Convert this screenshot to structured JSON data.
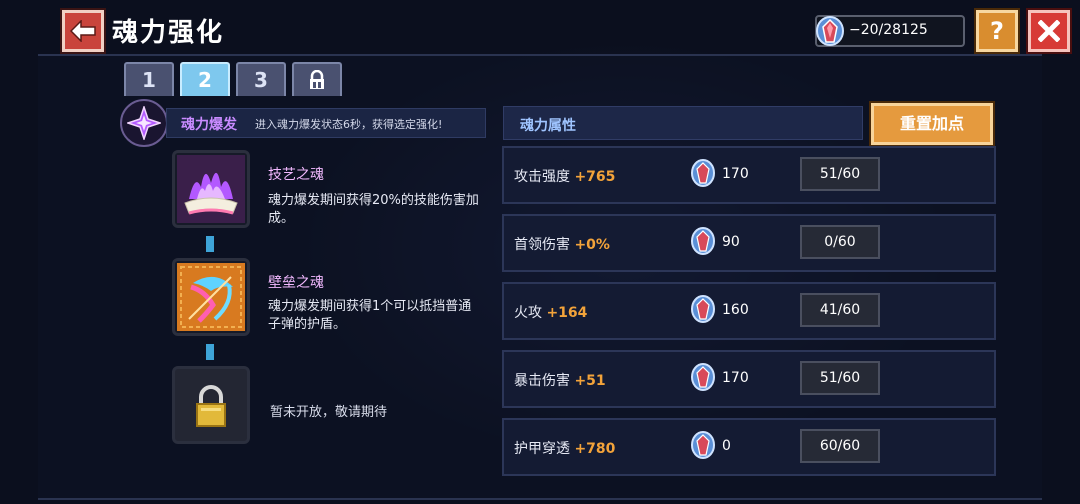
{
  "header": {
    "title": "魂力强化",
    "currency_value": "−20/28125",
    "help_label": "?"
  },
  "tabs": [
    {
      "label": "1",
      "active": false
    },
    {
      "label": "2",
      "active": true
    },
    {
      "label": "3",
      "active": false
    },
    {
      "label": "",
      "icon": "lock-icon",
      "active": false
    }
  ],
  "burst": {
    "name": "魂力爆发",
    "description": "进入魂力爆发状态6秒，获得选定强化!"
  },
  "souls": [
    {
      "name": "技艺之魂",
      "description": "魂力爆发期间获得20%的技能伤害加成。",
      "icon": "purple-flame-icon"
    },
    {
      "name": "壁垒之魂",
      "description": "魂力爆发期间获得1个可以抵挡普通子弹的护盾。",
      "icon": "shield-bow-icon"
    },
    {
      "name": "",
      "description": "暂未开放，敬请期待",
      "icon": "padlock-icon"
    }
  ],
  "attributes": {
    "header": "魂力属性",
    "reset_label": "重置加点",
    "rows": [
      {
        "label": "攻击强度",
        "bonus": "+765",
        "cost": "170",
        "level": "51/60"
      },
      {
        "label": "首领伤害",
        "bonus": "+0%",
        "cost": "90",
        "level": "0/60"
      },
      {
        "label": "火攻",
        "bonus": "+164",
        "cost": "160",
        "level": "41/60"
      },
      {
        "label": "暴击伤害",
        "bonus": "+51",
        "cost": "170",
        "level": "51/60"
      },
      {
        "label": "护甲穿透",
        "bonus": "+780",
        "cost": "0",
        "level": "60/60"
      }
    ]
  },
  "colors": {
    "accent_orange": "#e59a3e",
    "tab_active": "#7ec8ee",
    "bonus": "#f3a33a",
    "soul_name": "#f2b9ff"
  }
}
